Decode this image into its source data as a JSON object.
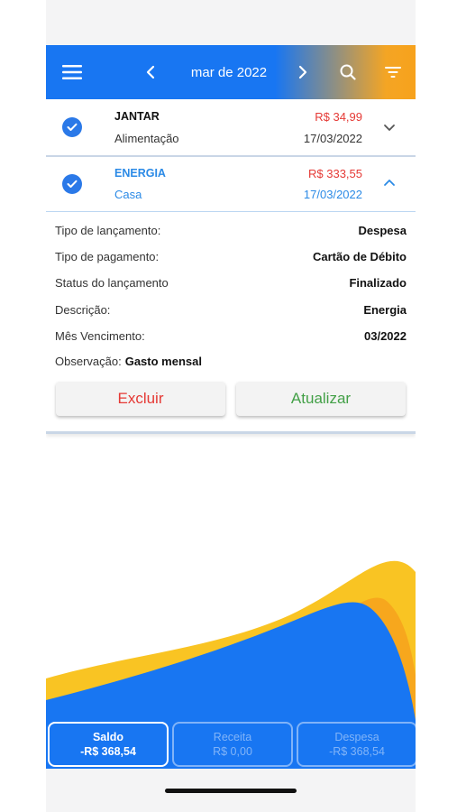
{
  "header": {
    "month_label": "mar de 2022",
    "icons": [
      "menu-icon",
      "chevron-left-icon",
      "chevron-right-icon",
      "search-icon",
      "filter-icon"
    ]
  },
  "entries": [
    {
      "title": "JANTAR",
      "category": "Alimentação",
      "amount": "R$ 34,99",
      "date": "17/03/2022",
      "expanded": false
    },
    {
      "title": "ENERGIA",
      "category": "Casa",
      "amount": "R$ 333,55",
      "date": "17/03/2022",
      "expanded": true
    }
  ],
  "details": {
    "rows": [
      {
        "label": "Tipo de lançamento:",
        "value": "Despesa"
      },
      {
        "label": "Tipo de pagamento:",
        "value": "Cartão de Débito"
      },
      {
        "label": "Status do lançamento",
        "value": "Finalizado"
      },
      {
        "label": "Descrição:",
        "value": "Energia"
      },
      {
        "label": "Mês Vencimento:",
        "value": "03/2022"
      }
    ],
    "observation_label": "Observação:",
    "observation_value": "Gasto mensal",
    "delete_label": "Excluir",
    "update_label": "Atualizar"
  },
  "tabs": [
    {
      "label": "Saldo",
      "value": "-R$ 368,54",
      "active": true
    },
    {
      "label": "Receita",
      "value": "R$ 0,00",
      "active": false
    },
    {
      "label": "Despesa",
      "value": "-R$ 368,54",
      "active": false
    }
  ],
  "colors": {
    "primary": "#1876f2",
    "accent": "#f7a21c",
    "wave_yellow": "#f9c423",
    "expense_red": "#e53935",
    "update_green": "#43a047",
    "link_blue": "#2b8ae6"
  }
}
